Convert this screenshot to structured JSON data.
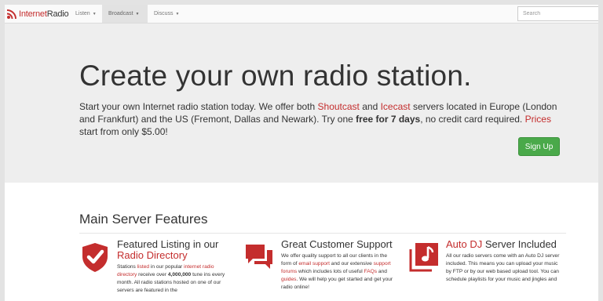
{
  "brand": {
    "part1": "Internet",
    "part2": "Radio"
  },
  "nav": {
    "listen": "Listen",
    "broadcast": "Broadcast",
    "discuss": "Discuss",
    "caret": "▼"
  },
  "search": {
    "placeholder": "Search"
  },
  "hero": {
    "title": "Create your own radio station.",
    "lead_1": "Start your own Internet radio station today. We offer both ",
    "shoutcast": "Shoutcast",
    "lead_2": " and ",
    "icecast": "Icecast",
    "lead_3": " servers located in Europe (London and Frankfurt) and the US (Fremont, Dallas and Newark). Try one ",
    "trial": "free for 7 days",
    "lead_4": ", no credit card required. ",
    "prices": "Prices",
    "lead_5": " start from only $5.00!",
    "signup_label": "Sign Up"
  },
  "features_title": "Main Server Features",
  "features": [
    {
      "icon": "shield-check-icon",
      "title_1": "Featured Listing in our ",
      "title_link": "Radio Directory",
      "t1": "Stations ",
      "l1": "listed",
      "t2": " in our popular ",
      "l2": "internet radio directory",
      "t3": " receive over ",
      "b1": "4,000,000",
      "t4": " tune ins every month. All radio stations hosted on one of our servers are featured in the"
    },
    {
      "icon": "chat-bubbles-icon",
      "title": "Great Customer Support",
      "t1": "We offer quality support to all our clients in the form of ",
      "l1": "email support",
      "t2": " and our extensive ",
      "l2": "support forums",
      "t3": " which includes lots of useful ",
      "l3": "FAQs",
      "t4": " and ",
      "l4": "guides",
      "t5": ". We will help you get started and get your radio online!"
    },
    {
      "icon": "music-note-icon",
      "title_link": "Auto DJ",
      "title_2": " Server Included",
      "text": "All our radio servers come with an Auto DJ server included. This means you can upload your music by FTP or by our web based upload tool. You can schedule playlists for your music and jingles and"
    }
  ],
  "colors": {
    "brand_red": "#c42d2d",
    "signup_green": "#4aa94a",
    "hero_bg": "#eeeeee"
  }
}
